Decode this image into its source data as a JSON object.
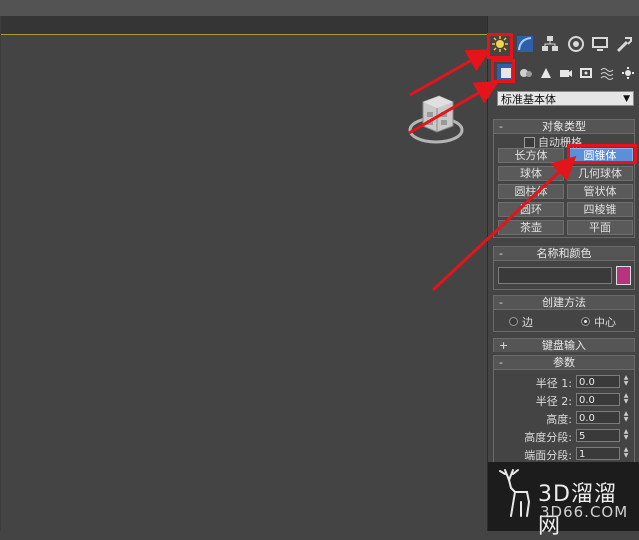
{
  "panel": {
    "category_dropdown": "标准基本体",
    "rollouts": {
      "object_type": {
        "sign": "-",
        "title": "对象类型",
        "autogrid_label": "自动栅格",
        "buttons": [
          "长方体",
          "圆锥体",
          "球体",
          "几何球体",
          "圆柱体",
          "管状体",
          "圆环",
          "四棱锥",
          "茶壶",
          "平面"
        ],
        "selected_button": "圆锥体"
      },
      "name_color": {
        "sign": "-",
        "title": "名称和颜色",
        "name_value": "",
        "color": "#b8337d"
      },
      "creation_method": {
        "sign": "-",
        "title": "创建方法",
        "option_edge": "边",
        "option_center": "中心",
        "selected": "中心"
      },
      "keyboard_entry": {
        "sign": "+",
        "title": "键盘输入"
      },
      "parameters": {
        "sign": "-",
        "title": "参数",
        "rows": [
          {
            "label": "半径 1:",
            "value": "0.0"
          },
          {
            "label": "半径 2:",
            "value": "0.0"
          },
          {
            "label": "高度:",
            "value": "0.0"
          },
          {
            "label": "高度分段:",
            "value": "5"
          },
          {
            "label": "端面分段:",
            "value": "1"
          }
        ]
      }
    }
  },
  "watermark": {
    "brand": "3D溜溜网",
    "url": "3D66.COM"
  },
  "colors": {
    "highlight": "#e4141a",
    "selected_button": "#5b8fd8",
    "viewport_border": "#a89b3e"
  }
}
